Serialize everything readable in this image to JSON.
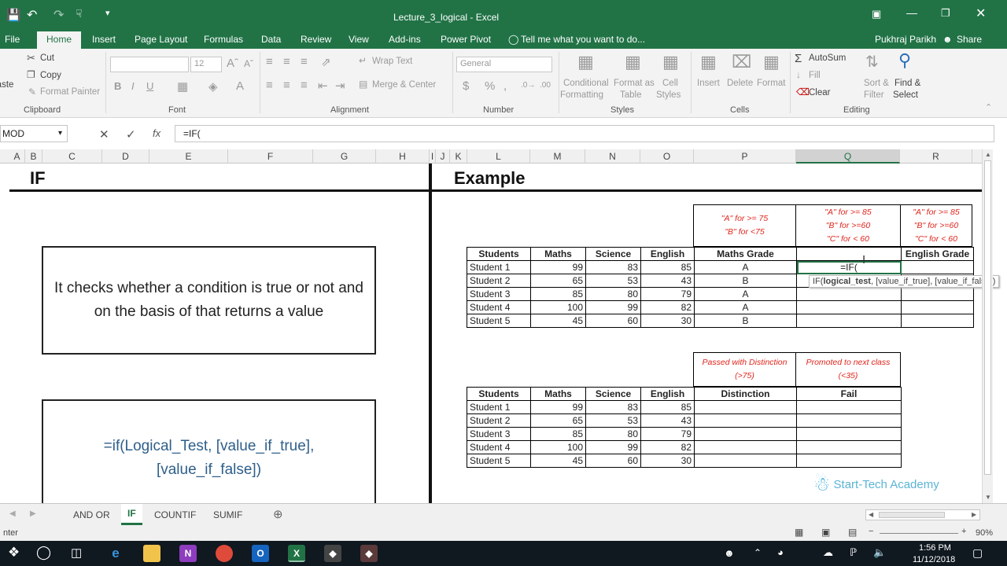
{
  "window": {
    "title": "Lecture_3_logical - Excel",
    "user": "Pukhraj Parikh",
    "share": "Share",
    "tell_me": "Tell me what you want to do..."
  },
  "menu": [
    "File",
    "Home",
    "Insert",
    "Page Layout",
    "Formulas",
    "Data",
    "Review",
    "View",
    "Add-ins",
    "Power Pivot"
  ],
  "ribbon": {
    "clipboard": {
      "paste": "Paste",
      "cut": "Cut",
      "copy": "Copy",
      "format_painter": "Format Painter",
      "label": "Clipboard"
    },
    "font": {
      "size": "12",
      "label": "Font"
    },
    "alignment": {
      "wrap": "Wrap Text",
      "merge": "Merge & Center",
      "label": "Alignment"
    },
    "number": {
      "format": "General",
      "label": "Number"
    },
    "styles": {
      "cond": "Conditional",
      "cond2": "Formatting",
      "table": "Format as",
      "table2": "Table",
      "cell": "Cell",
      "cell2": "Styles",
      "label": "Styles"
    },
    "cells": {
      "insert": "Insert",
      "delete": "Delete",
      "format": "Format",
      "label": "Cells"
    },
    "editing": {
      "autosum": "AutoSum",
      "fill": "Fill",
      "clear": "Clear",
      "sort": "Sort &",
      "sort2": "Filter",
      "find": "Find &",
      "find2": "Select",
      "label": "Editing"
    }
  },
  "formula_bar": {
    "name_box": "MOD",
    "content": "=IF("
  },
  "columns": [
    "A",
    "B",
    "C",
    "D",
    "E",
    "F",
    "G",
    "H",
    "I",
    "J",
    "K",
    "L",
    "M",
    "N",
    "O",
    "P",
    "Q",
    "R"
  ],
  "left_panel": {
    "title": "IF",
    "description": "It checks whether a condition is true or not and on the basis of that returns a value",
    "syntax": "=if(Logical_Test, [value_if_true], [value_if_false])"
  },
  "right_panel": {
    "title": "Example",
    "notes_top": [
      "\"A\" for >= 75\n\"B\" for <75",
      "\"A\" for >= 85\n\"B\" for >=60\n\"C\" for < 60",
      "\"A\" for >= 85\n\"B\" for >=60\n\"C\" for < 60"
    ],
    "table1": {
      "headers": [
        "Students",
        "Maths",
        "Science",
        "English",
        "Maths Grade",
        "",
        "English Grade"
      ],
      "rows": [
        [
          "Student 1",
          "99",
          "83",
          "85",
          "A",
          "=IF(",
          ""
        ],
        [
          "Student 2",
          "65",
          "53",
          "43",
          "B",
          "",
          ""
        ],
        [
          "Student 3",
          "85",
          "80",
          "79",
          "A",
          "",
          ""
        ],
        [
          "Student 4",
          "100",
          "99",
          "82",
          "A",
          "",
          ""
        ],
        [
          "Student 5",
          "45",
          "60",
          "30",
          "B",
          "",
          ""
        ]
      ]
    },
    "tooltip": {
      "fn": "IF(",
      "arg1": "logical_test",
      "rest": ", [value_if_true], [value_if_false])"
    },
    "notes_bottom": [
      "Passed with Distinction\n(>75)",
      "Promoted to next class\n(<35)"
    ],
    "table2": {
      "headers": [
        "Students",
        "Maths",
        "Science",
        "English",
        "Distinction",
        "Fail"
      ],
      "rows": [
        [
          "Student 1",
          "99",
          "83",
          "85",
          "",
          ""
        ],
        [
          "Student 2",
          "65",
          "53",
          "43",
          "",
          ""
        ],
        [
          "Student 3",
          "85",
          "80",
          "79",
          "",
          ""
        ],
        [
          "Student 4",
          "100",
          "99",
          "82",
          "",
          ""
        ],
        [
          "Student 5",
          "45",
          "60",
          "30",
          "",
          ""
        ]
      ]
    },
    "logo": "Start-Tech Academy"
  },
  "sheet_tabs": [
    "AND OR",
    "IF",
    "COUNTIF",
    "SUMIF"
  ],
  "active_tab": "IF",
  "status": {
    "mode": "nter",
    "zoom": "90%"
  },
  "taskbar": {
    "time": "1:56 PM",
    "date": "11/12/2018"
  },
  "colors": {
    "excel_green": "#217346",
    "note_red": "#e0241b",
    "syntax_blue": "#2e5f8a"
  }
}
